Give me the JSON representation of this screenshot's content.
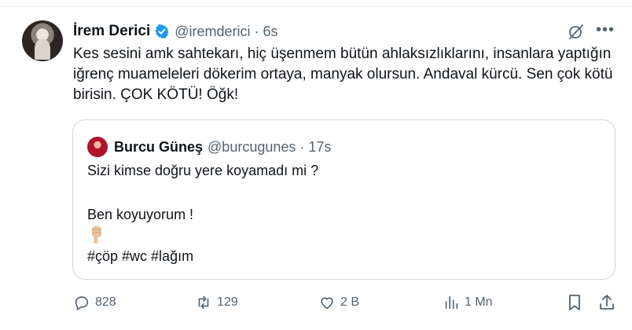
{
  "tweet": {
    "author_name": "İrem Derici",
    "handle": "@iremderici",
    "separator": "·",
    "time": "6s",
    "text": "Kes sesini amk sahtekarı, hiç üşenmem bütün ahlaksızlıklarını, insanlara yaptığın iğrenç muameleleri dökerim ortaya, manyak olursun. Andaval kürcü. Sen çok kötü birisin. ÇOK KÖTÜ! Öğk!"
  },
  "quote": {
    "author_name": "Burcu Güneş",
    "handle": "@burcugunes",
    "separator": "·",
    "time": "17s",
    "line1": "Sizi kimse doğru yere koyamadı mi ?",
    "line2": "Ben koyuyorum !",
    "line3": "#çöp #wc #lağım"
  },
  "actions": {
    "replies": "828",
    "reposts": "129",
    "likes": "2 B",
    "views": "1 Mn"
  },
  "icons": {
    "verified": "verified-badge-icon",
    "grok": "grok-icon",
    "more": "more-icon",
    "reply": "reply-icon",
    "repost": "repost-icon",
    "like": "heart-icon",
    "views": "analytics-icon",
    "bookmark": "bookmark-icon",
    "share": "share-icon",
    "emoji": "pointing-down-emoji"
  },
  "colors": {
    "text": "#0f1419",
    "secondary": "#536471",
    "verified": "#1d9bf0",
    "border": "#cfd9de"
  }
}
